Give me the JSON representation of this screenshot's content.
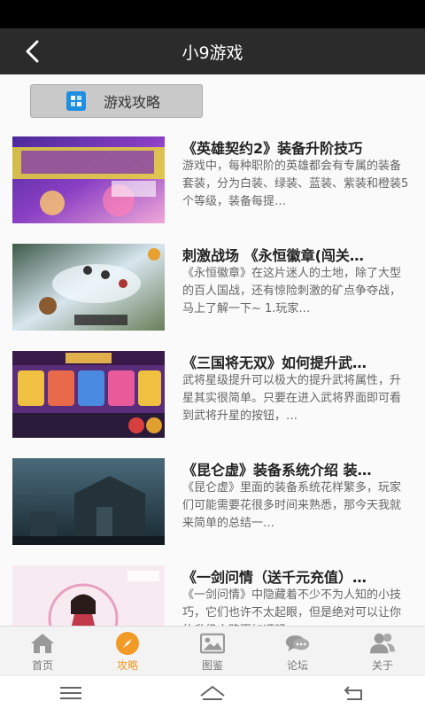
{
  "header": {
    "title": "小9游戏",
    "back_icon": "back-arrow-icon"
  },
  "section": {
    "label": "游戏攻略",
    "icon": "grid-icon",
    "accent": "#1e8fe0"
  },
  "articles": [
    {
      "title": "《英雄契约2》装备升阶技巧",
      "desc": "游戏中，每种职阶的英雄都会有专属的装备套装，分为白装、绿装、蓝装、紫装和橙装5个等级，装备每提…"
    },
    {
      "title": "刺激战场 《永恒徽章(闯关…",
      "desc": "《永恒徽章》在这片迷人的土地，除了大型的百人国战，还有惊险刺激的矿点争夺战，马上了解一下~ 1.玩家…"
    },
    {
      "title": "《三国将无双》如何提升武…",
      "desc": "武将星级提升可以极大的提升武将属性，升星其实很简单。只要在进入武将界面即可看到武将升星的按钮，…"
    },
    {
      "title": "《昆仑虚》装备系统介绍 装…",
      "desc": "《昆仑虚》里面的装备系统花样繁多，玩家们可能需要花很多时间来熟悉，那今天我就来简单的总结一…"
    },
    {
      "title": "《一剑问情（送千元充值）…",
      "desc": "《一剑问情》中隐藏着不少不为人知的小技巧，它们也许不太起眼，但是绝对可以让你的升级之路更加顺畅…"
    }
  ],
  "tabs": [
    {
      "label": "首页",
      "icon": "home-icon"
    },
    {
      "label": "攻略",
      "icon": "compass-icon"
    },
    {
      "label": "图鉴",
      "icon": "image-icon"
    },
    {
      "label": "论坛",
      "icon": "chat-icon"
    },
    {
      "label": "关于",
      "icon": "people-icon"
    }
  ],
  "active_tab": "攻略",
  "colors": {
    "header_bg": "#2b2b2b",
    "active_tab": "#f29a26",
    "inactive_tab": "#999999"
  },
  "system_nav": [
    "menu-icon",
    "home-outline-icon",
    "back-icon"
  ]
}
